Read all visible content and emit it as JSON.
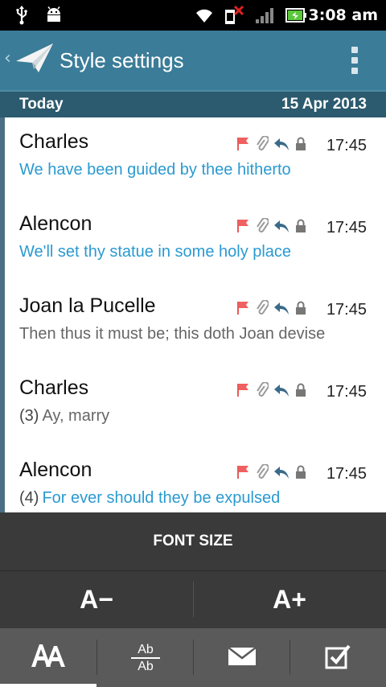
{
  "status_bar": {
    "time": "3:08 am",
    "icons": [
      "usb-icon",
      "android-debug-icon",
      "wifi-icon",
      "no-sim-icon",
      "signal-icon",
      "battery-icon"
    ]
  },
  "action_bar": {
    "title": "Style settings",
    "icons": [
      "back-chevron-icon",
      "paper-plane-logo-icon",
      "overflow-menu-icon"
    ],
    "colors": {
      "background": "#3b7c98"
    }
  },
  "date_header": {
    "label": "Today",
    "date": "15 Apr 2013"
  },
  "messages": [
    {
      "sender": "Charles",
      "count": "",
      "subject": "We have been guided by thee hitherto",
      "time": "17:45",
      "unread": true
    },
    {
      "sender": "Alencon",
      "count": "",
      "subject": "We'll set thy statue in some holy place",
      "time": "17:45",
      "unread": true
    },
    {
      "sender": "Joan la Pucelle",
      "count": "",
      "subject": "Then thus it must be; this doth Joan devise",
      "time": "17:45",
      "unread": false
    },
    {
      "sender": "Charles",
      "count": "(3)",
      "subject": "Ay, marry",
      "time": "17:45",
      "unread": false
    },
    {
      "sender": "Alencon",
      "count": "(4)",
      "subject": "For ever should they be expulsed",
      "time": "17:45",
      "unread": true
    }
  ],
  "message_icons": [
    "flag-icon",
    "attachment-icon",
    "reply-icon",
    "lock-icon"
  ],
  "font_panel": {
    "title": "FONT SIZE",
    "decrease_label": "A−",
    "increase_label": "A+"
  },
  "toolbar": {
    "tabs": [
      {
        "name": "font-size-tab",
        "icon": "font-size-icon",
        "active": true
      },
      {
        "name": "text-style-tab",
        "icon": "text-style-icon",
        "label_top": "Ab",
        "label_bottom": "Ab"
      },
      {
        "name": "envelope-tab",
        "icon": "envelope-icon"
      },
      {
        "name": "checkbox-tab",
        "icon": "checkbox-icon"
      }
    ]
  },
  "colors": {
    "unread_subject": "#2a9ad0",
    "read_subject": "#666666",
    "flag": "#f06060",
    "panel": "#3a3a3a",
    "toolbar": "#5a5a5a"
  }
}
